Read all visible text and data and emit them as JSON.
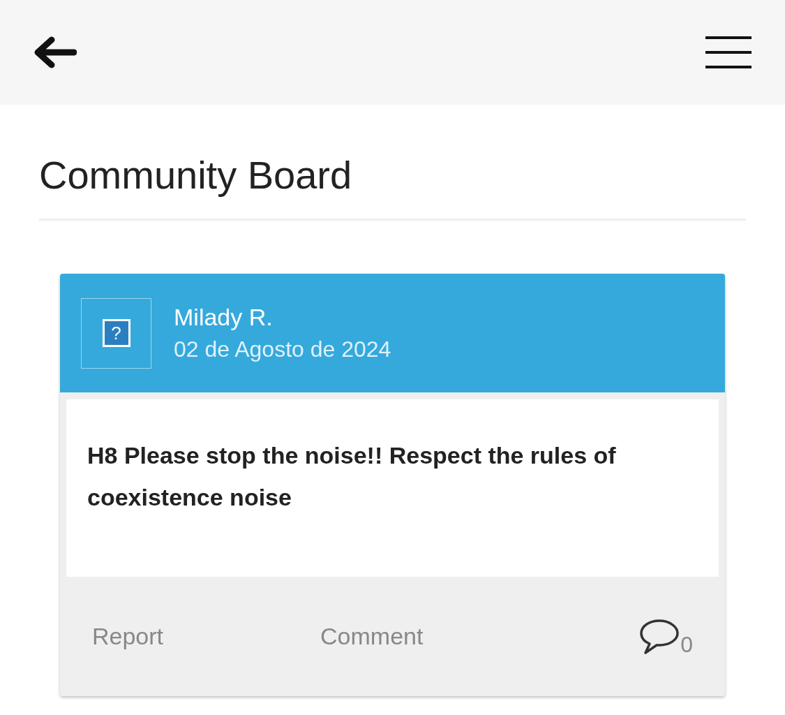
{
  "header": {
    "title": "Community Board"
  },
  "posts": [
    {
      "author": "Milady R.",
      "date": "02 de Agosto de 2024",
      "avatar_glyph": "?",
      "text": "H8 Please stop the noise!! Respect the rules of coexistence noise",
      "actions": [
        "Report",
        "Comment"
      ],
      "comment_count": "0"
    }
  ]
}
